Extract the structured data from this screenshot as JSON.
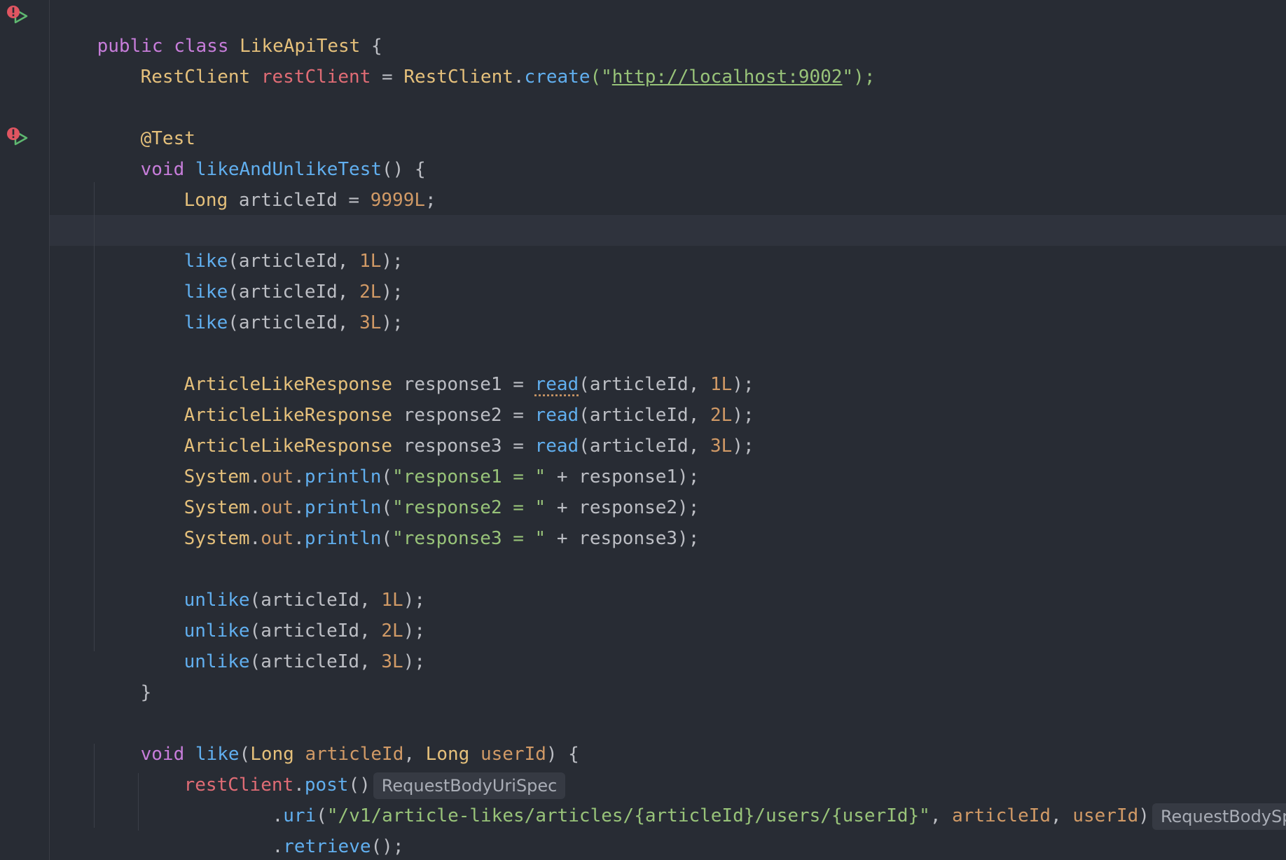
{
  "code": {
    "class_decl": {
      "public": "public",
      "class": "class",
      "name": "LikeApiTest",
      "brace": " {"
    },
    "rest_field": {
      "type": "RestClient",
      "name": "restClient",
      "eq": " = ",
      "cls": "RestClient",
      "dot": ".",
      "method": "create",
      "open": "(\"",
      "url": "http://localhost:9002",
      "close": "\");"
    },
    "annotation": "@Test",
    "test_decl": {
      "void": "void",
      "name": "likeAndUnlikeTest",
      "rest": "() {"
    },
    "article_id": {
      "type": "Long",
      "text": " articleId = ",
      "value": "9999L",
      "semi": ";"
    },
    "like_calls": [
      {
        "fn": "like",
        "a": "(articleId, ",
        "n": "1L",
        "b": ");"
      },
      {
        "fn": "like",
        "a": "(articleId, ",
        "n": "2L",
        "b": ");"
      },
      {
        "fn": "like",
        "a": "(articleId, ",
        "n": "3L",
        "b": ");"
      }
    ],
    "read_calls": [
      {
        "type": "ArticleLikeResponse",
        "var": " response1 = ",
        "fn": "read",
        "a": "(articleId, ",
        "n": "1L",
        "b": ");"
      },
      {
        "type": "ArticleLikeResponse",
        "var": " response2 = ",
        "fn": "read",
        "a": "(articleId, ",
        "n": "2L",
        "b": ");"
      },
      {
        "type": "ArticleLikeResponse",
        "var": " response3 = ",
        "fn": "read",
        "a": "(articleId, ",
        "n": "3L",
        "b": ");"
      }
    ],
    "print_calls": [
      {
        "sys": "System",
        "dot": ".",
        "out": "out",
        "dot2": ".",
        "fn": "println",
        "open": "(",
        "str": "\"response1 = \"",
        "rest": " + response1);"
      },
      {
        "sys": "System",
        "dot": ".",
        "out": "out",
        "dot2": ".",
        "fn": "println",
        "open": "(",
        "str": "\"response2 = \"",
        "rest": " + response2);"
      },
      {
        "sys": "System",
        "dot": ".",
        "out": "out",
        "dot2": ".",
        "fn": "println",
        "open": "(",
        "str": "\"response3 = \"",
        "rest": " + response3);"
      }
    ],
    "unlike_calls": [
      {
        "fn": "unlike",
        "a": "(articleId, ",
        "n": "1L",
        "b": ");"
      },
      {
        "fn": "unlike",
        "a": "(articleId, ",
        "n": "2L",
        "b": ");"
      },
      {
        "fn": "unlike",
        "a": "(articleId, ",
        "n": "3L",
        "b": ");"
      }
    ],
    "close_brace": "}",
    "like_decl": {
      "void": "void",
      "name": "like",
      "open": "(",
      "t1": "Long",
      "p1": "articleId",
      "comma": ", ",
      "t2": "Long",
      "p2": "userId",
      "close": ") {"
    },
    "post_line": {
      "field": "restClient",
      "dot": ".",
      "fn": "post",
      "parens": "()",
      "hint": "RequestBodyUriSpec"
    },
    "uri_line": {
      "dot": ".",
      "fn": "uri",
      "open": "(",
      "str": "\"/v1/article-likes/articles/{articleId}/users/{userId}\"",
      "comma": ", ",
      "p1": "articleId",
      "comma2": ", ",
      "p2": "userId",
      "close": ")",
      "hint": "RequestBodySpec"
    },
    "retrieve_line": {
      "dot": ".",
      "fn": "retrieve",
      "rest": "();"
    }
  },
  "colors": {
    "background": "#282c34",
    "keyword": "#c77dda",
    "class": "#e5c07b",
    "field": "#e06c75",
    "function": "#61afef",
    "string": "#98c379",
    "number": "#d19a66",
    "run_icon": "#5fb870",
    "error_icon": "#e05561"
  }
}
